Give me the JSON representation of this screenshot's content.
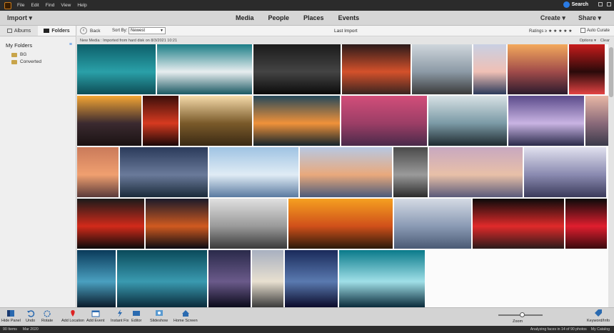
{
  "menubar": {
    "items": [
      "File",
      "Edit",
      "Find",
      "View",
      "Help"
    ],
    "search_label": "Search"
  },
  "navbar": {
    "import_label": "Import",
    "tabs": [
      "Media",
      "People",
      "Places",
      "Events"
    ],
    "create_label": "Create",
    "share_label": "Share"
  },
  "sidebar": {
    "tabs": [
      "Albums",
      "Folders"
    ],
    "section_title": "My Folders",
    "folders": [
      "BG",
      "Converted"
    ]
  },
  "toolbar": {
    "back_label": "Back",
    "sort_label": "Sort By:",
    "sort_value": "Newest",
    "title": "Last Import",
    "ratings_label": "Ratings ≥ ★ ★ ★ ★ ★",
    "auto_curate_label": "Auto Curate"
  },
  "subbar": {
    "info": "New Media : Imported from hard disk on 8/3/2021 10:21",
    "options_label": "Options",
    "clear_label": "Clear"
  },
  "bottombar": {
    "buttons": [
      "Hide Panel",
      "Undo",
      "Rotate",
      "Add Location",
      "Add Event",
      "Instant Fix",
      "Editor",
      "Slideshow",
      "Home Screen"
    ],
    "zoom_label": "Zoom",
    "keyword_label": "Keyword/Info",
    "zoom_level": 0.5
  },
  "statusbar": {
    "items_count": "90 Items",
    "date": "Mar 2020",
    "analysis": "Analyzing faces in 14 of 90 photos",
    "catalog": "My Catalog"
  },
  "photos": [
    {
      "name": "ocean-aerial",
      "colors": [
        "#0d5f6a",
        "#2aa0a8",
        "#0e4c55"
      ]
    },
    {
      "name": "waves-shore",
      "colors": [
        "#1a7d86",
        "#e8eef0",
        "#1a5963"
      ]
    },
    {
      "name": "rain-drops",
      "colors": [
        "#1b1b1b",
        "#444",
        "#0a0a0a"
      ]
    },
    {
      "name": "red-clouds",
      "colors": [
        "#2a1a1a",
        "#d4512b",
        "#3a2420"
      ]
    },
    {
      "name": "street-lamp",
      "colors": [
        "#cfd6dc",
        "#8c9aa6",
        "#3a3a3a"
      ]
    },
    {
      "name": "mountain-dusk",
      "colors": [
        "#c8d0e3",
        "#f0c0b5",
        "#2b3a5a"
      ]
    },
    {
      "name": "hills-sunset",
      "colors": [
        "#f3a95c",
        "#a04b4a",
        "#2b1b2d"
      ]
    },
    {
      "name": "lone-tree-red",
      "colors": [
        "#c81c1c",
        "#2a0a0a",
        "#e34343"
      ]
    },
    {
      "name": "couple-tree-sunset",
      "colors": [
        "#f5a634",
        "#3b2a30",
        "#1a1212"
      ]
    },
    {
      "name": "bokeh-red",
      "colors": [
        "#3a0e0a",
        "#d63a20",
        "#1a0707"
      ]
    },
    {
      "name": "meadow-sun",
      "colors": [
        "#f5dbaa",
        "#7a5a2a",
        "#3a2a14"
      ]
    },
    {
      "name": "lake-sunset",
      "colors": [
        "#24485a",
        "#f0923a",
        "#12232c"
      ]
    },
    {
      "name": "pink-lake",
      "colors": [
        "#d24e7a",
        "#9c3e66",
        "#4a2a4a"
      ]
    },
    {
      "name": "trees-silhouette",
      "colors": [
        "#d7e1e4",
        "#7b9aa6",
        "#1f2a2f"
      ]
    },
    {
      "name": "misty-island",
      "colors": [
        "#5a4a8a",
        "#c9b4e3",
        "#2a2a4a"
      ]
    },
    {
      "name": "fog-pink",
      "colors": [
        "#e8b7a5",
        "#8a6a7a",
        "#3a3a4a"
      ]
    },
    {
      "name": "sun-pyramid",
      "colors": [
        "#c97a5a",
        "#f0a070",
        "#5a3a3a"
      ]
    },
    {
      "name": "snowy-mountain",
      "colors": [
        "#2a3a5a",
        "#6a7a9a",
        "#1a2a3a"
      ]
    },
    {
      "name": "fuji-blue",
      "colors": [
        "#9fc3e3",
        "#e0ecf5",
        "#5a7aa0"
      ]
    },
    {
      "name": "peak-blue",
      "colors": [
        "#b7c8e2",
        "#e9a97c",
        "#4a5a7a"
      ]
    },
    {
      "name": "layered-clouds",
      "colors": [
        "#4a4a4a",
        "#9a9a9a",
        "#2a2a2a"
      ]
    },
    {
      "name": "pastel-hills",
      "colors": [
        "#c8a8c0",
        "#e8c0a8",
        "#5a5a7a"
      ]
    },
    {
      "name": "purple-range",
      "colors": [
        "#e0e0ee",
        "#8a8ab0",
        "#3a3a5a"
      ]
    },
    {
      "name": "man-red-smoke",
      "colors": [
        "#8a0a0a",
        "#e02020",
        "#1a0505"
      ]
    },
    {
      "name": "red-moon",
      "colors": [
        "#1a1a1a",
        "#d22a1a",
        "#0a0a0a"
      ]
    },
    {
      "name": "golden-gate-night",
      "colors": [
        "#1a1a2a",
        "#d05a20",
        "#0a0a12"
      ]
    },
    {
      "name": "golden-gate-fog",
      "colors": [
        "#e0e0e0",
        "#9a9a9a",
        "#3a3a3a"
      ]
    },
    {
      "name": "orange-horizon",
      "colors": [
        "#f5a020",
        "#d0501a",
        "#2a1a0a"
      ]
    },
    {
      "name": "pale-hills",
      "colors": [
        "#d4dae4",
        "#8a9ab4",
        "#4a5a74"
      ]
    },
    {
      "name": "red-jellyfish",
      "colors": [
        "#0a0a0a",
        "#e02a2a",
        "#2a1a1a"
      ]
    },
    {
      "name": "red-keyboard",
      "colors": [
        "#0a0a0a",
        "#e01e2e",
        "#3a0a0e"
      ]
    },
    {
      "name": "blue-lake",
      "colors": [
        "#4a9ae0",
        "#a8d4f5",
        "#1a4a7a"
      ]
    },
    {
      "name": "blue-wave",
      "colors": [
        "#0a3a5a",
        "#4aa0c0",
        "#0a1a2a"
      ]
    },
    {
      "name": "underwater-rays",
      "colors": [
        "#0a4a5a",
        "#3a9ab0",
        "#0a2a3a"
      ]
    },
    {
      "name": "night-hill",
      "colors": [
        "#2a2a4a",
        "#6a5a8a",
        "#0a0a1a"
      ]
    },
    {
      "name": "rocky-shore",
      "colors": [
        "#a8b0c0",
        "#e8e0d0",
        "#3a3a3a"
      ]
    },
    {
      "name": "galaxy-stars",
      "colors": [
        "#1a2a5a",
        "#5a7ab0",
        "#0a0a2a"
      ]
    },
    {
      "name": "wave-tunnel",
      "colors": [
        "#0a7a8a",
        "#a0e0e8",
        "#0a2a3a"
      ]
    }
  ]
}
